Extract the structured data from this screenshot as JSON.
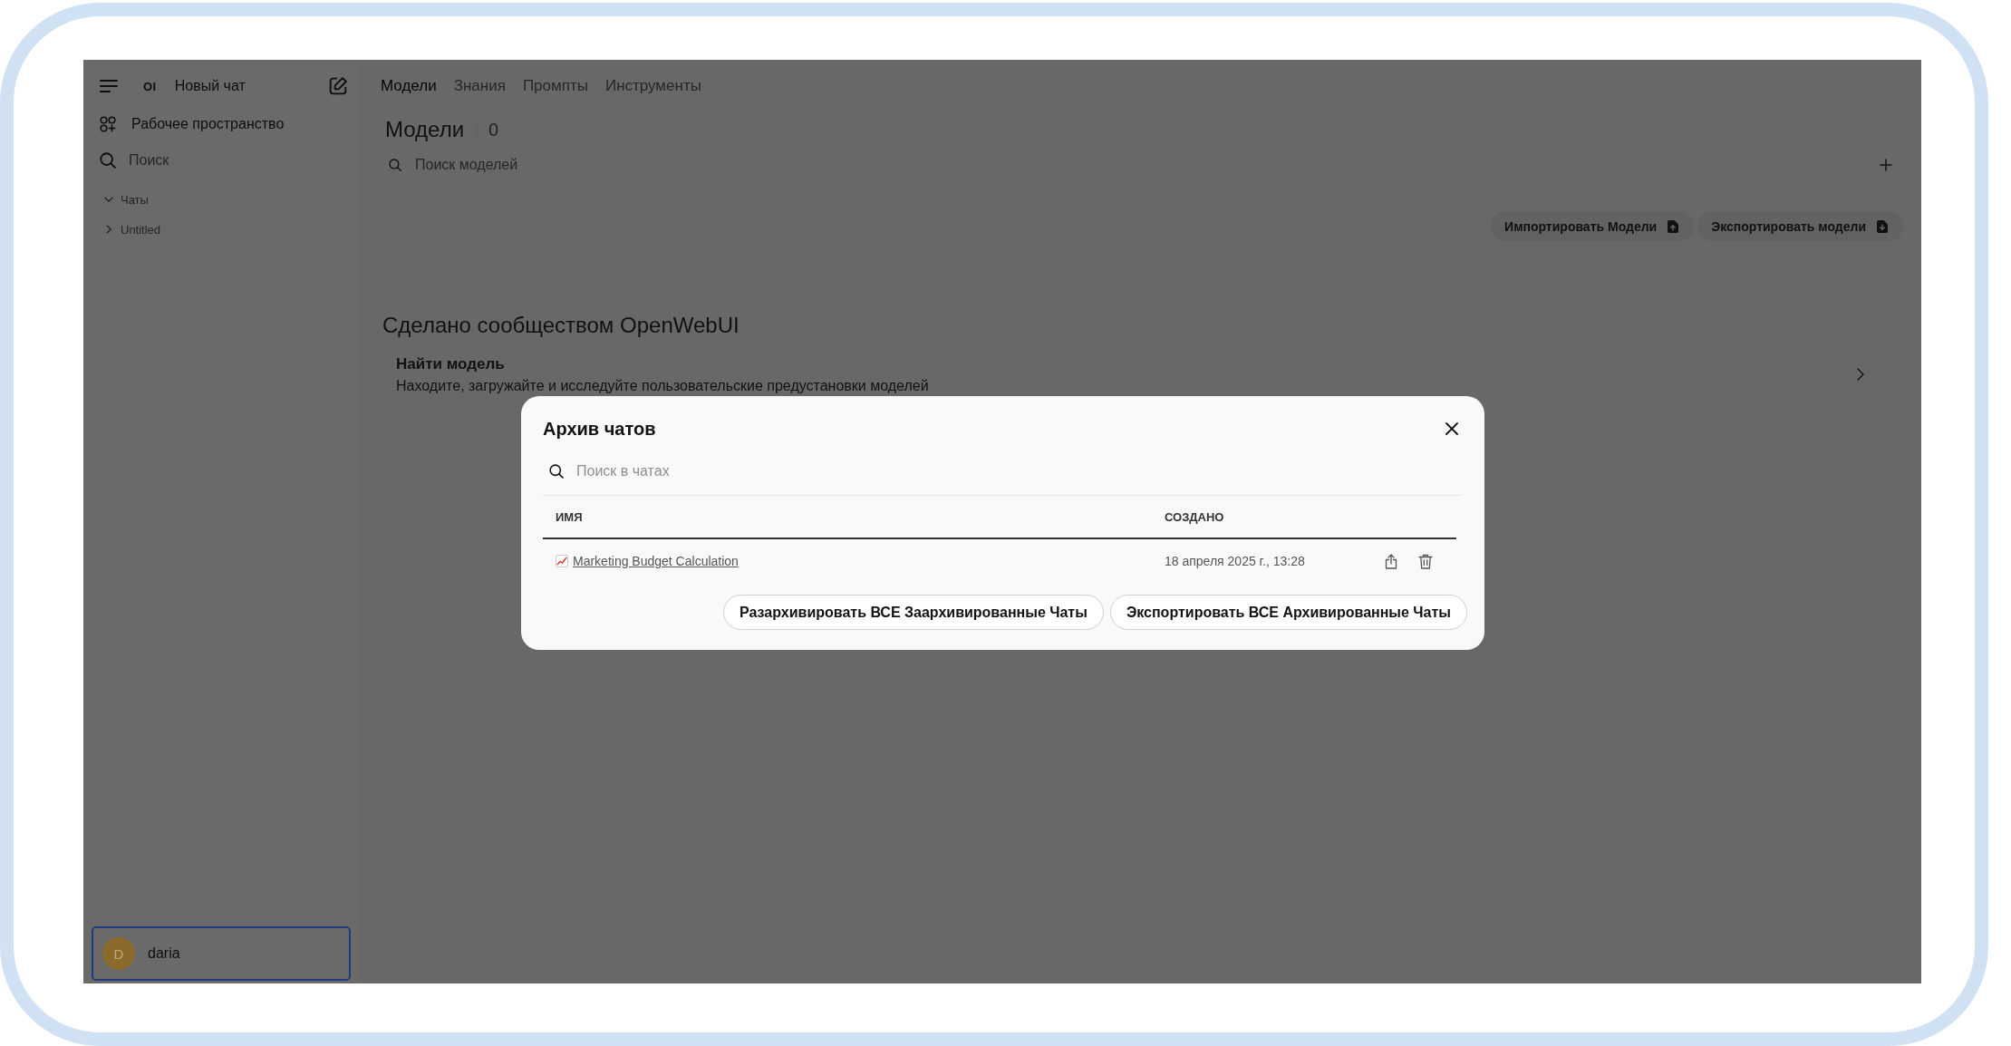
{
  "sidebar": {
    "logo": "OI",
    "new_chat": "Новый чат",
    "workspace": "Рабочее пространство",
    "search": {
      "placeholder": "Поиск"
    },
    "folders": [
      {
        "label": "Чаты",
        "expanded": true
      },
      {
        "label": "Untitled",
        "expanded": false
      }
    ],
    "user": {
      "initial": "D",
      "name": "daria",
      "focused": true
    }
  },
  "main": {
    "tabs": [
      {
        "label": "Модели",
        "selected": true
      },
      {
        "label": "Знания",
        "selected": false
      },
      {
        "label": "Промпты",
        "selected": false
      },
      {
        "label": "Инструменты",
        "selected": false
      }
    ],
    "title": "Модели",
    "count": "0",
    "search": {
      "placeholder": "Поиск моделей"
    },
    "actions": [
      {
        "kind": "import",
        "label": "Импортировать Модели"
      },
      {
        "kind": "export",
        "label": "Экспортировать модели"
      }
    ],
    "community": {
      "heading": "Сделано сообществом OpenWebUI",
      "title": "Найти модель",
      "description": "Находите, загружайте и исследуйте пользовательские предустановки моделей"
    }
  },
  "dialog": {
    "title": "Архив чатов",
    "search": {
      "placeholder": "Поиск в чатах"
    },
    "columns": [
      "ИМЯ",
      "СОЗДАНО"
    ],
    "rows": [
      {
        "name": "Marketing Budget Calculation",
        "created": "18 апреля 2025 г., 13:28"
      }
    ],
    "buttons": [
      "Разархивировать ВСЕ Заархивированные Чаты",
      "Экспортировать ВСЕ Архивированные Чаты"
    ]
  }
}
